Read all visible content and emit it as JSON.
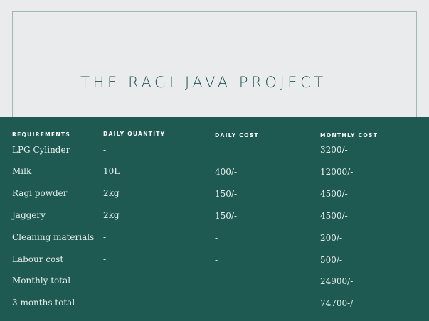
{
  "title": "THE RAGI JAVA PROJECT",
  "colors": {
    "panel": "#1f5a52",
    "background": "#e9ebec",
    "title": "#1f564f"
  },
  "table": {
    "headers": [
      "REQUIREMENTS",
      "DAILY QUANTITY",
      "DAILY COST",
      "MONTHLY COST"
    ],
    "rows": [
      [
        "LPG Cylinder",
        "-",
        "-",
        "3200/-"
      ],
      [
        "Milk",
        "10L",
        "400/-",
        "12000/-"
      ],
      [
        "Ragi powder",
        "2kg",
        "150/-",
        "4500/-"
      ],
      [
        "Jaggery",
        "2kg",
        "150/-",
        "4500/-"
      ],
      [
        "Cleaning materials",
        "-",
        "-",
        "200/-"
      ],
      [
        "Labour cost",
        "-",
        "-",
        "500/-"
      ],
      [
        "Monthly total",
        "",
        "",
        "24900/-"
      ],
      [
        "3 months total",
        "",
        "",
        "74700-/"
      ]
    ]
  }
}
